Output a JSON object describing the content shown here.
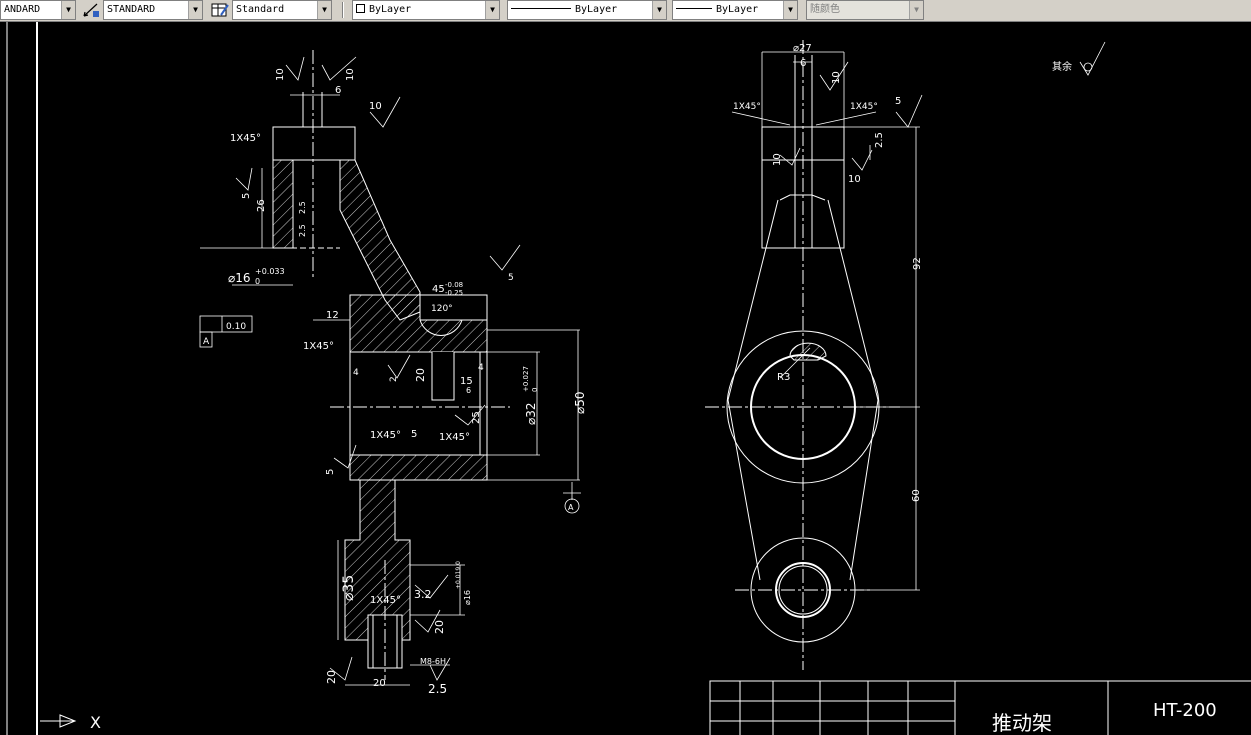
{
  "toolbar": {
    "text_style": "ANDARD",
    "dim_style": "STANDARD",
    "table_style": "Standard",
    "layer": "ByLayer",
    "linetype": "ByLayer",
    "lineweight": "ByLayer",
    "plot_style": "随颜色"
  },
  "drawing": {
    "surface_other": "其余",
    "left_view": {
      "r10a": "10",
      "r10b": "10",
      "w6": "6",
      "r10c": "10",
      "chamfer_top": "1X45°",
      "r5_side": "5",
      "h26": "26",
      "r25a": "2.5",
      "r25b": "2.5",
      "dia16": "⌀16",
      "tol16_up": "+0.033",
      "tol16_low": "0",
      "d12": "12",
      "tol_frame": "0.10",
      "datum_a": "A",
      "chamfer_mid": "1X45°",
      "d45": "45",
      "tol45_up": "-0.08",
      "tol45_low": "-0.25",
      "r5_right": "5",
      "ang120": "120°",
      "d4a": "4",
      "d2": "2",
      "r20a": "20",
      "d15": "15",
      "d4b": "4",
      "d6": "6",
      "d25": "25",
      "dia32": "⌀32",
      "tol32_up": "+0.027",
      "tol32_low": "0",
      "dia50": "⌀50",
      "chamfer_l": "1X45°",
      "d5c": "5",
      "chamfer_r": "1X45°",
      "r5_left": "5",
      "datum_a2": "A",
      "dia35": "⌀35",
      "chamfer_low": "1X45°",
      "r32": "3.2",
      "dia16b": "⌀16",
      "tol16b": "+0.019 0",
      "r20b": "20",
      "thread": "M8-6H",
      "r20c": "20",
      "d20": "20",
      "r25c": "2.5"
    },
    "right_view": {
      "dia27": "⌀27",
      "w6": "6",
      "r10a": "10",
      "chamfer_l": "1X45°",
      "chamfer_r": "1X45°",
      "r5": "5",
      "d25": "2.5",
      "r10b": "10",
      "r10c": "10",
      "d92": "92",
      "r3": "R3",
      "d60": "60"
    }
  },
  "title_block": {
    "part_name": "推动架",
    "material": "HT-200"
  },
  "ucs": {
    "x_label": "X"
  }
}
